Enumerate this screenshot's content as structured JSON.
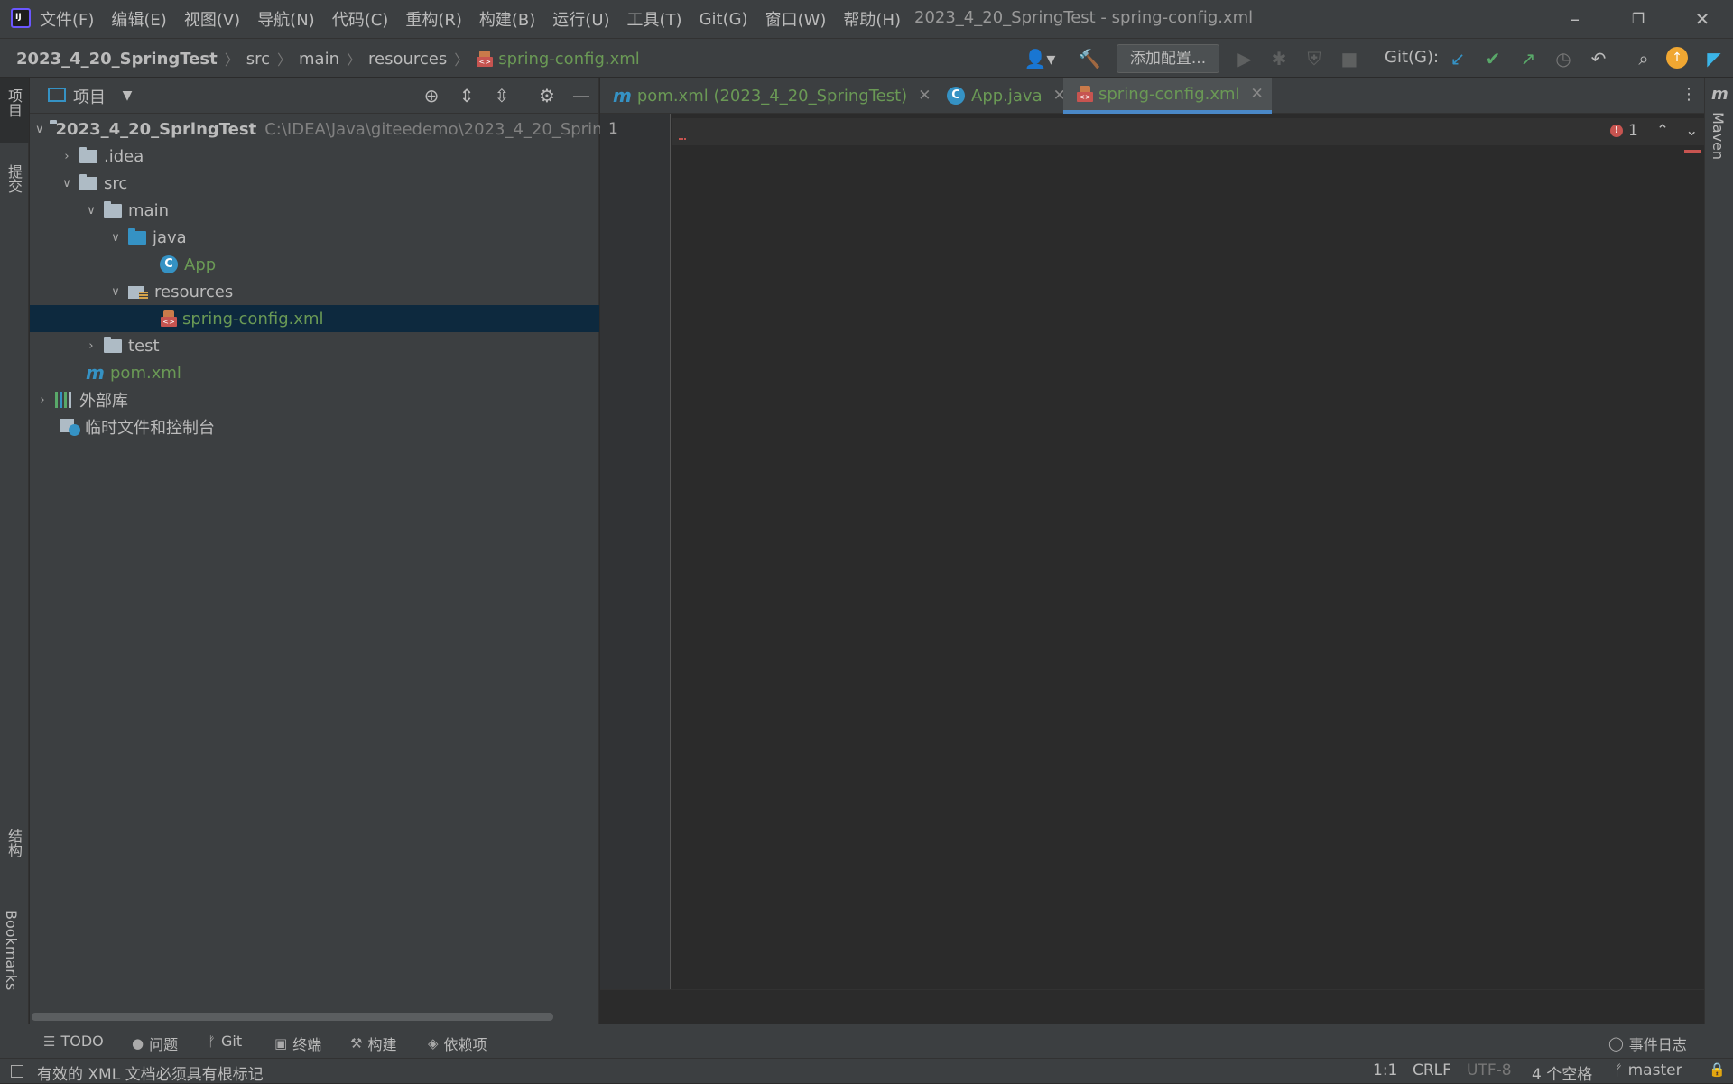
{
  "menubar": {
    "items": [
      "文件(F)",
      "编辑(E)",
      "视图(V)",
      "导航(N)",
      "代码(C)",
      "重构(R)",
      "构建(B)",
      "运行(U)",
      "工具(T)",
      "Git(G)",
      "窗口(W)",
      "帮助(H)"
    ],
    "window_title": "2023_4_20_SpringTest - spring-config.xml"
  },
  "breadcrumb": {
    "project": "2023_4_20_SpringTest",
    "src": "src",
    "main": "main",
    "resources": "resources",
    "file": "spring-config.xml"
  },
  "toolbar": {
    "add_config": "添加配置...",
    "git_label": "Git(G):"
  },
  "left_strip": {
    "project_tab": "项目",
    "commit_tab": "提交",
    "structure_tab": "结构",
    "bookmarks_tab": "Bookmarks"
  },
  "right_strip": {
    "maven_tab": "Maven"
  },
  "project_panel": {
    "title": "项目",
    "tree": {
      "root": "2023_4_20_SpringTest",
      "root_path": "C:\\IDEA\\Java\\giteedemo\\2023_4_20_Sprin",
      "idea": ".idea",
      "src": "src",
      "main": "main",
      "java": "java",
      "app": "App",
      "resources": "resources",
      "config": "spring-config.xml",
      "test": "test",
      "pom": "pom.xml",
      "external_libs": "外部库",
      "scratches": "临时文件和控制台"
    }
  },
  "editor": {
    "tabs": [
      {
        "label": "pom.xml (2023_4_20_SpringTest)",
        "icon": "maven-icon"
      },
      {
        "label": "App.java",
        "icon": "class-icon"
      },
      {
        "label": "spring-config.xml",
        "icon": "xml-icon",
        "active": true
      }
    ],
    "line_number": "1",
    "error_count": "1"
  },
  "toolwindow_bar": {
    "todo": "TODO",
    "problems": "问题",
    "git": "Git",
    "terminal": "终端",
    "build": "构建",
    "dependencies": "依赖项",
    "event_log": "事件日志"
  },
  "statusbar": {
    "message": "有效的 XML 文档必须具有根标记",
    "position": "1:1",
    "line_sep": "CRLF",
    "encoding": "UTF-8",
    "indent": "4 个空格",
    "branch": "master"
  },
  "colors": {
    "accent": "#4a88c7",
    "error": "#c75450",
    "vcs_added_text": "#6a9955",
    "background": "#2b2b2b",
    "panel": "#3c3f41"
  }
}
